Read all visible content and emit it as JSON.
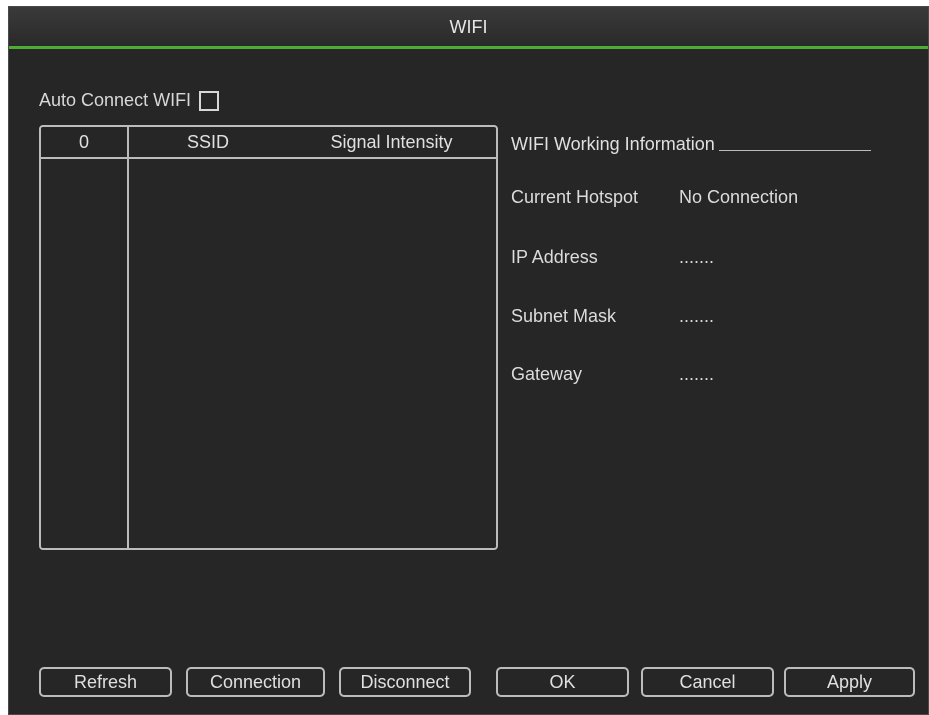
{
  "window": {
    "title": "WIFI"
  },
  "auto_connect": {
    "label": "Auto Connect WIFI",
    "checked": false
  },
  "table": {
    "headers": [
      "0",
      "SSID",
      "Signal Intensity"
    ],
    "rows": []
  },
  "info": {
    "heading": "WIFI Working Information",
    "current_hotspot": {
      "label": "Current Hotspot",
      "value": "No Connection"
    },
    "ip_address": {
      "label": "IP Address",
      "value": "......."
    },
    "subnet_mask": {
      "label": "Subnet Mask",
      "value": "......."
    },
    "gateway": {
      "label": "Gateway",
      "value": "......."
    }
  },
  "buttons": {
    "refresh": "Refresh",
    "connection": "Connection",
    "disconnect": "Disconnect",
    "ok": "OK",
    "cancel": "Cancel",
    "apply": "Apply"
  },
  "colors": {
    "background": "#262626",
    "accent": "#4caf34",
    "text": "#e0e0e0",
    "border": "#bcbcbc"
  }
}
